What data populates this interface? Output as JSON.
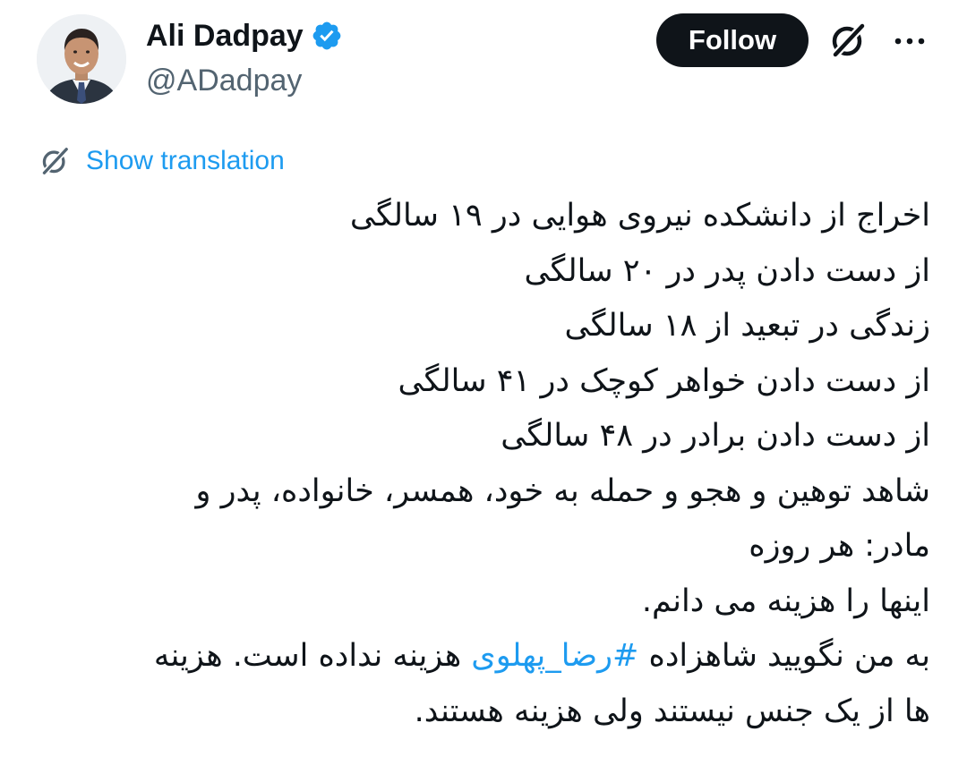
{
  "author": {
    "display_name": "Ali Dadpay",
    "handle": "@ADadpay",
    "verified": true,
    "avatar_icon": "profile-photo"
  },
  "actions": {
    "follow_label": "Follow",
    "grok_icon": "grok-icon",
    "more_icon": "more-dots-icon"
  },
  "translation": {
    "icon": "grok-icon",
    "label": "Show translation"
  },
  "tweet": {
    "lines": [
      {
        "text": "اخراج از دانشکده نیروی هوایی در ۱۹ سالگی"
      },
      {
        "text": "از دست دادن پدر در ۲۰ سالگی"
      },
      {
        "text": "زندگی در تبعید از ۱۸ سالگی"
      },
      {
        "text": "از دست دادن خواهر کوچک در ۴۱ سالگی"
      },
      {
        "text": "از دست دادن برادر در ۴۸ سالگی"
      },
      {
        "text": "شاهد توهین و هجو و حمله به خود، همسر، خانواده، پدر و"
      },
      {
        "text": "مادر: هر روزه"
      },
      {
        "text": "اینها را هزینه می دانم."
      },
      {
        "before": "به من نگویید شاهزاده ",
        "hashtag": "#رضا_پهلوی",
        "after": " هزینه نداده است. هزینه"
      },
      {
        "text": "ها از یک جنس نیستند ولی هزینه هستند."
      }
    ]
  },
  "colors": {
    "text": "#0f1419",
    "secondary": "#536471",
    "accent": "#1d9bf0",
    "follow_bg": "#0f1419"
  }
}
